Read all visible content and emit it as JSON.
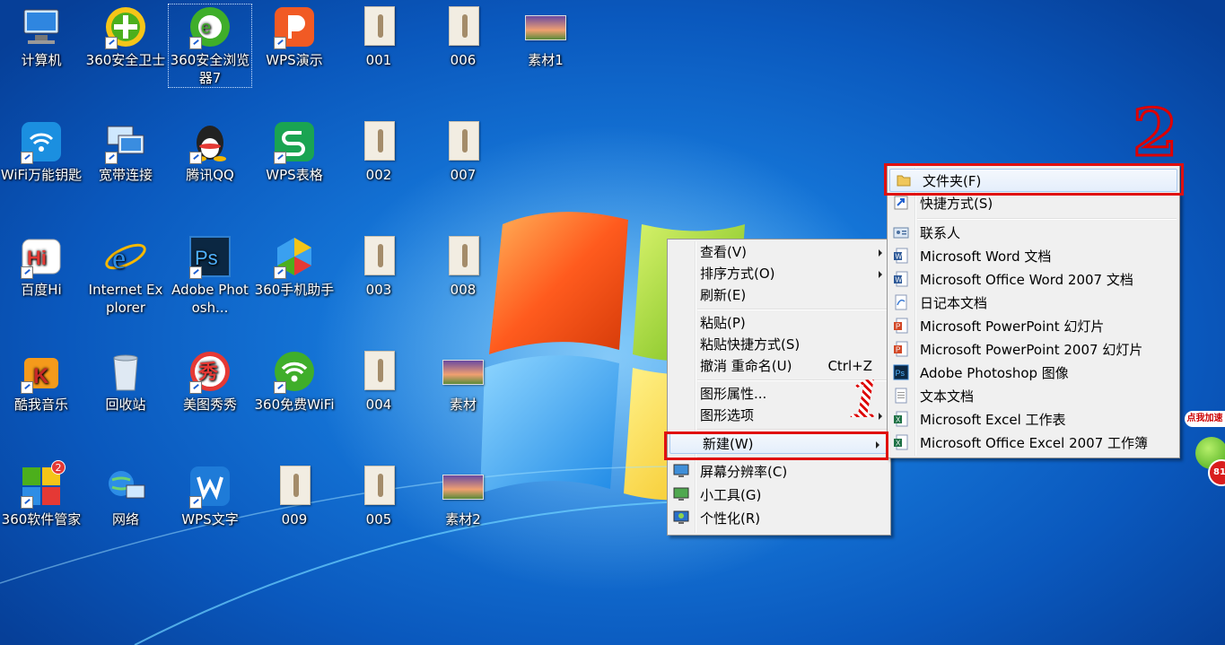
{
  "desktop": {
    "icons": [
      {
        "label": "计算机",
        "type": "computer"
      },
      {
        "label": "360安全卫士",
        "type": "360-guard"
      },
      {
        "label": "360安全浏览器7",
        "type": "360-browser"
      },
      {
        "label": "WPS演示",
        "type": "wps-presentation"
      },
      {
        "label": "001",
        "type": "image"
      },
      {
        "label": "006",
        "type": "image"
      },
      {
        "label": "素材1",
        "type": "landscape"
      },
      {
        "label": "WiFi万能钥匙",
        "type": "wifi-key"
      },
      {
        "label": "宽带连接",
        "type": "broadband"
      },
      {
        "label": "腾讯QQ",
        "type": "qq"
      },
      {
        "label": "WPS表格",
        "type": "wps-sheet"
      },
      {
        "label": "002",
        "type": "image"
      },
      {
        "label": "007",
        "type": "image"
      },
      {
        "label": "百度Hi",
        "type": "baidu-hi"
      },
      {
        "label": "Internet Explorer",
        "type": "ie"
      },
      {
        "label": "Adobe Photosh...",
        "type": "photoshop"
      },
      {
        "label": "360手机助手",
        "type": "360-phone"
      },
      {
        "label": "003",
        "type": "image"
      },
      {
        "label": "008",
        "type": "image"
      },
      {
        "label": "酷我音乐",
        "type": "kuwo"
      },
      {
        "label": "回收站",
        "type": "recycle-bin"
      },
      {
        "label": "美图秀秀",
        "type": "meitu"
      },
      {
        "label": "360免费WiFi",
        "type": "360-wifi"
      },
      {
        "label": "004",
        "type": "image"
      },
      {
        "label": "素材",
        "type": "landscape"
      },
      {
        "label": "360软件管家",
        "type": "360-soft"
      },
      {
        "label": "网络",
        "type": "network"
      },
      {
        "label": "WPS文字",
        "type": "wps-writer"
      },
      {
        "label": "009",
        "type": "image"
      },
      {
        "label": "005",
        "type": "image"
      },
      {
        "label": "素材2",
        "type": "landscape"
      }
    ]
  },
  "context_menu": {
    "items": [
      {
        "label": "查看(V)",
        "submenu": true
      },
      {
        "label": "排序方式(O)",
        "submenu": true
      },
      {
        "label": "刷新(E)"
      },
      {
        "label": "粘贴(P)"
      },
      {
        "label": "粘贴快捷方式(S)"
      },
      {
        "label": "撤消 重命名(U)",
        "shortcut": "Ctrl+Z"
      },
      {
        "label": "图形属性..."
      },
      {
        "label": "图形选项",
        "submenu": true
      },
      {
        "label": "新建(W)",
        "submenu": true,
        "highlighted": true
      },
      {
        "label": "屏幕分辨率(C)",
        "icon": "display-icon"
      },
      {
        "label": "小工具(G)",
        "icon": "gadgets-icon"
      },
      {
        "label": "个性化(R)",
        "icon": "personalize-icon"
      }
    ]
  },
  "new_submenu": {
    "items": [
      {
        "label": "文件夹(F)",
        "icon": "folder-icon",
        "highlighted": true
      },
      {
        "label": "快捷方式(S)",
        "icon": "shortcut-icon"
      },
      {
        "label": "联系人",
        "icon": "contact-icon"
      },
      {
        "label": "Microsoft Word 文档",
        "icon": "word-icon"
      },
      {
        "label": "Microsoft Office Word 2007 文档",
        "icon": "word-icon"
      },
      {
        "label": "日记本文档",
        "icon": "journal-icon"
      },
      {
        "label": "Microsoft PowerPoint 幻灯片",
        "icon": "powerpoint-icon"
      },
      {
        "label": "Microsoft PowerPoint 2007 幻灯片",
        "icon": "powerpoint-icon"
      },
      {
        "label": "Adobe Photoshop 图像",
        "icon": "photoshop-icon"
      },
      {
        "label": "文本文档",
        "icon": "text-icon"
      },
      {
        "label": "Microsoft Excel 工作表",
        "icon": "excel-icon"
      },
      {
        "label": "Microsoft Office Excel 2007 工作簿",
        "icon": "excel-icon"
      }
    ]
  },
  "annotations": {
    "step1": "1",
    "step2": "2"
  },
  "widget": {
    "speedup_label": "点我加速",
    "badge": "81"
  },
  "badges": {
    "soft_manager": "2"
  },
  "colors": {
    "highlight_box": "#e01010",
    "desktop_blue": "#1576d8"
  }
}
